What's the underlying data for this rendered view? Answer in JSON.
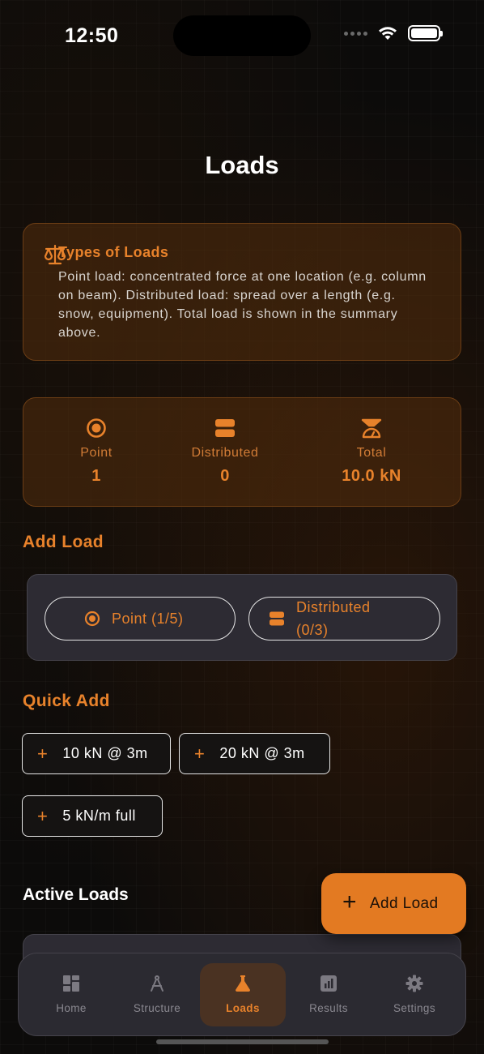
{
  "status": {
    "time": "12:50"
  },
  "page": {
    "title": "Loads"
  },
  "info": {
    "title": "Types of Loads",
    "body": "Point load: concentrated force at one location (e.g. column on beam). Distributed load: spread over a length (e.g. snow, equipment). Total load is shown in the summary above.",
    "icon": "scale-icon"
  },
  "stats": [
    {
      "label": "Point",
      "value": "1",
      "icon": "target-icon"
    },
    {
      "label": "Distributed",
      "value": "0",
      "icon": "distributed-icon"
    },
    {
      "label": "Total",
      "value": "10.0 kN",
      "icon": "weight-scale-icon"
    }
  ],
  "add_load": {
    "section_title": "Add Load",
    "point_button": "Point (1/5)",
    "distributed_button_line1": "Distributed",
    "distributed_button_line2": "(0/3)"
  },
  "quick_add": {
    "section_title": "Quick Add",
    "chips": [
      "10 kN @ 3m",
      "20 kN @ 3m",
      "5 kN/m full"
    ]
  },
  "active_loads": {
    "title": "Active Loads"
  },
  "fab": {
    "label": "Add Load"
  },
  "tabbar": {
    "tabs": [
      {
        "label": "Home",
        "icon": "dashboard-icon"
      },
      {
        "label": "Structure",
        "icon": "compass-icon"
      },
      {
        "label": "Loads",
        "icon": "flask-icon"
      },
      {
        "label": "Results",
        "icon": "chart-icon"
      },
      {
        "label": "Settings",
        "icon": "gear-icon"
      }
    ],
    "active": "Loads"
  },
  "colors": {
    "accent": "#e8822b",
    "background": "#0c0b0a",
    "panel": "#2d2b33",
    "card": "#54300c"
  }
}
